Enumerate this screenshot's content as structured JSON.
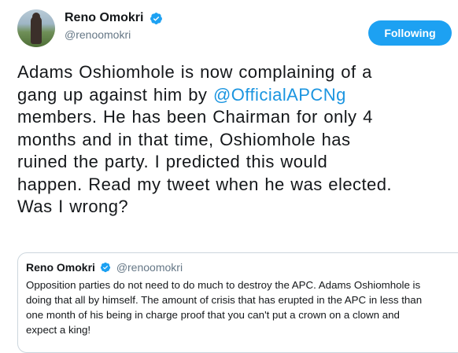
{
  "tweet": {
    "author_name": "Reno Omokri",
    "author_handle": "@renoomokri",
    "follow_label": "Following",
    "text_lines": [
      {
        "pre": "Adams Oshiomhole is now complaining of a",
        "mention": "",
        "post": ""
      },
      {
        "pre": "gang up against him by ",
        "mention": "@OfficialAPCNg",
        "post": ""
      },
      {
        "pre": "members. He has been Chairman for only 4",
        "mention": "",
        "post": ""
      },
      {
        "pre": "months and in that time, Oshiomhole has",
        "mention": "",
        "post": ""
      },
      {
        "pre": "ruined the party. I predicted this would",
        "mention": "",
        "post": ""
      },
      {
        "pre": "happen. Read my tweet when he was elected.",
        "mention": "",
        "post": ""
      },
      {
        "pre": "Was I wrong?",
        "mention": "",
        "post": ""
      }
    ]
  },
  "quoted_tweet": {
    "author_name": "Reno Omokri",
    "author_handle": "@renoomokri",
    "text_lines": [
      "Opposition parties do not need to do much to destroy the APC. Adams Oshiomhole is",
      "doing that all by himself. The amount of crisis that has erupted in the APC in less than",
      "one month of his being in charge proof that you can't put a crown on a clown and",
      "expect a king!"
    ]
  },
  "icons": {
    "verified": "verified-badge-icon",
    "caret": "chevron-down-icon"
  },
  "colors": {
    "accent": "#1da1f2",
    "mention": "#1b95e0",
    "muted": "#657786",
    "border": "#ccd6dd"
  }
}
